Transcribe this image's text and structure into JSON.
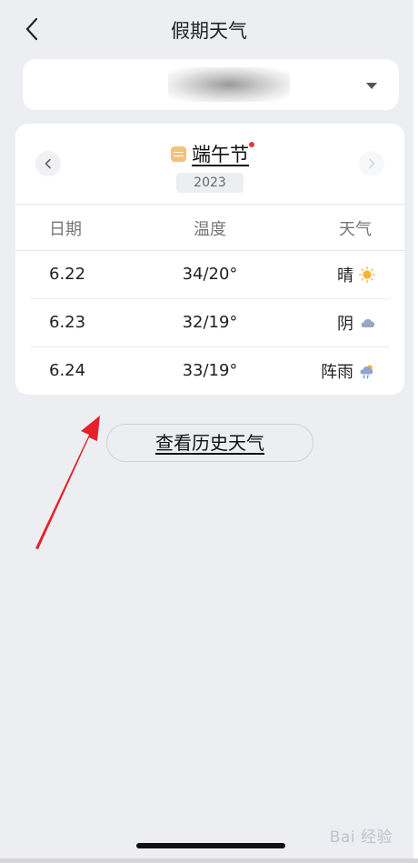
{
  "header": {
    "title": "假期天气",
    "back_icon": "chevron-left-icon"
  },
  "city_selector": {
    "value": "",
    "arrow_icon": "caret-down-icon"
  },
  "holiday": {
    "name": "端午节",
    "year": "2023",
    "calendar_icon": "calendar-icon",
    "has_new_dot": true
  },
  "table": {
    "headers": {
      "date": "日期",
      "temp": "温度",
      "weather": "天气"
    },
    "rows": [
      {
        "date": "6.22",
        "temp": "34/20°",
        "weather": "晴",
        "icon": "sun-icon"
      },
      {
        "date": "6.23",
        "temp": "32/19°",
        "weather": "阴",
        "icon": "cloud-icon"
      },
      {
        "date": "6.24",
        "temp": "33/19°",
        "weather": "阵雨",
        "icon": "shower-icon"
      }
    ]
  },
  "history_button": {
    "label": "查看历史天气"
  },
  "watermark": {
    "text": "Bai 经验"
  },
  "colors": {
    "background": "#eceef2",
    "card": "#ffffff",
    "annotation_arrow": "#e8202a",
    "sun": "#f7b234",
    "cloud": "#9aa6c4"
  }
}
